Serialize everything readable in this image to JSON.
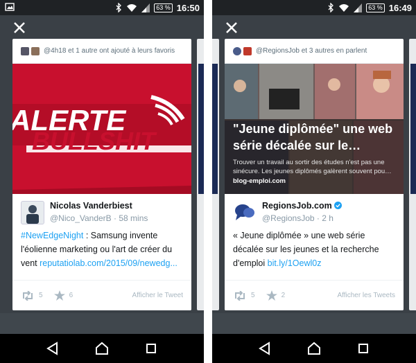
{
  "left": {
    "status": {
      "battery": "63 %",
      "time": "16:50"
    },
    "header_text": "@4h18 et 1 autre ont ajouté à leurs favoris",
    "media": {
      "line1": "ALERTE",
      "line2": "BULLSHIT"
    },
    "user": {
      "name": "Nicolas Vanderbiest",
      "handle": "@Nico_VanderB",
      "sep": "·",
      "time": "58 mins"
    },
    "tweet": {
      "hashtag": "#NewEdgeNight",
      "text": " : Samsung invente l'éolienne marketing ou l'art de créer du vent ",
      "url": "reputatiolab.com/2015/09/newedg..."
    },
    "actions": {
      "retweets": "5",
      "favorites": "6",
      "view_label": "Afficher le Tweet"
    }
  },
  "right": {
    "status": {
      "battery": "63 %",
      "time": "16:49"
    },
    "header_text": "@RegionsJob et 3 autres en parlent",
    "media": {
      "title": "\"Jeune diplômée\" une web série décalée sur le…",
      "desc": "Trouver un travail au sortir des études n'est pas une sinécure. Les jeunes diplômés galèrent souvent pou…",
      "domain": "blog-emploi.com"
    },
    "user": {
      "name": "RegionsJob.com",
      "handle": "@RegionsJob",
      "sep": "·",
      "time": "2 h"
    },
    "tweet": {
      "text": "« Jeune diplômée » une web série décalée sur les jeunes et la recherche d'emploi ",
      "url": "bit.ly/1Oewl0z"
    },
    "actions": {
      "retweets": "5",
      "favorites": "2",
      "view_label": "Afficher les Tweets"
    }
  },
  "colors": {
    "link": "#1da1f2",
    "verified": "#1da1f2",
    "alert_red": "#c8102e"
  }
}
